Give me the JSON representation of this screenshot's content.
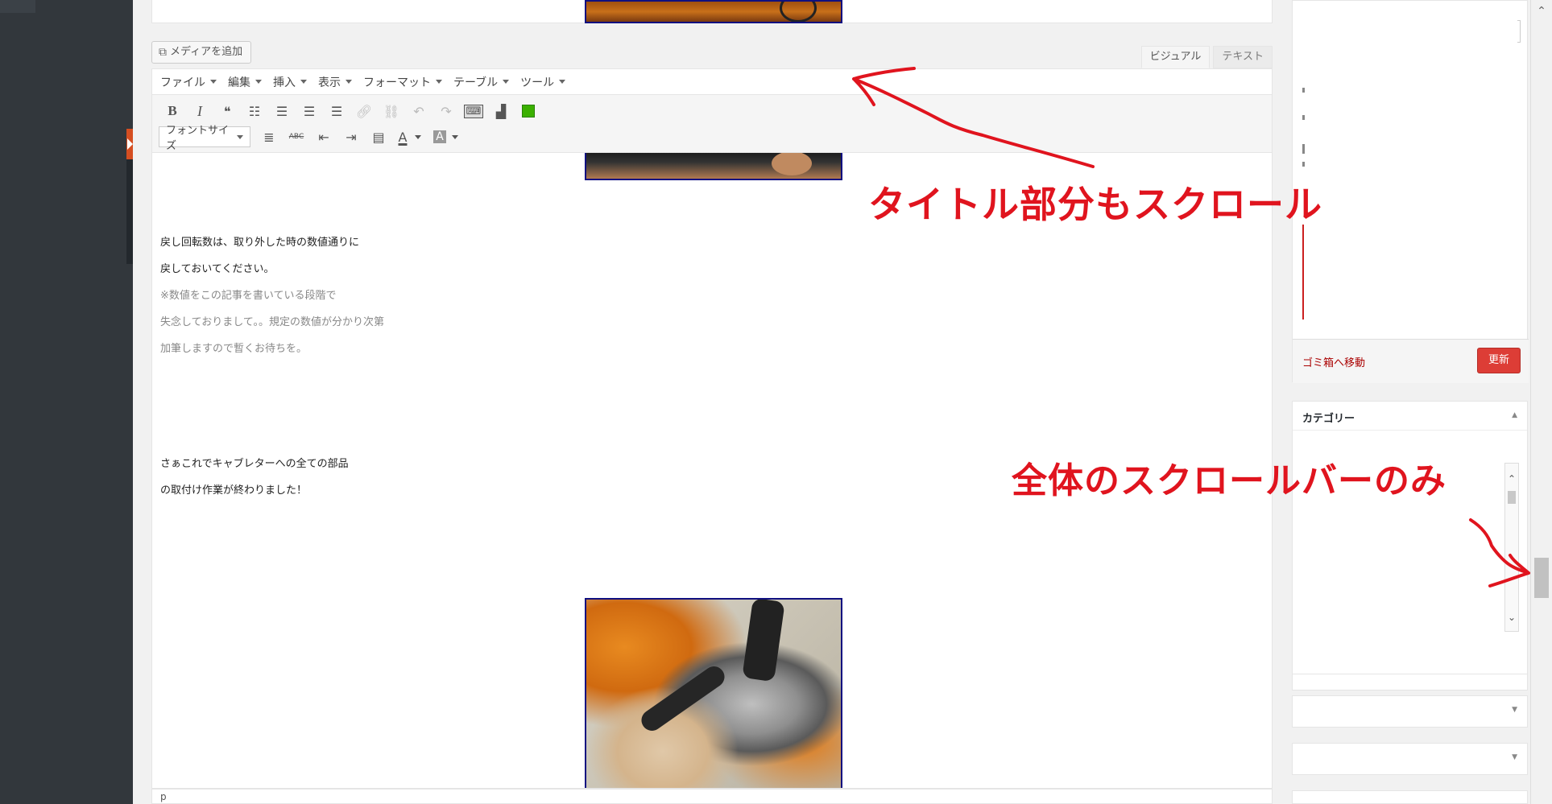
{
  "editor": {
    "add_media_label": "メディアを追加",
    "tabs": [
      {
        "label": "ビジュアル",
        "active": true
      },
      {
        "label": "テキスト",
        "active": false
      }
    ],
    "menu": [
      {
        "label": "ファイル"
      },
      {
        "label": "編集"
      },
      {
        "label": "挿入"
      },
      {
        "label": "表示"
      },
      {
        "label": "フォーマット"
      },
      {
        "label": "テーブル"
      },
      {
        "label": "ツール"
      }
    ],
    "toolbar": {
      "bold": "B",
      "italic": "I",
      "blockquote": "❝",
      "fontsize_label": "フォントサイズ",
      "strikethrough": "ABC",
      "text_color": "A",
      "bg_color": "A"
    },
    "content_lines": [
      {
        "text": "戻し回転数は、取り外した時の数値通りに",
        "style": "normal"
      },
      {
        "text": "戻しておいてください。",
        "style": "normal"
      },
      {
        "text": "※数値をこの記事を書いている段階で",
        "style": "gray"
      },
      {
        "text": "失念しておりまして。。規定の数値が分かり次第",
        "style": "gray"
      },
      {
        "text": "加筆しますので暫くお待ちを。",
        "style": "gray"
      },
      {
        "text": "さぁこれでキャブレターへの全ての部品",
        "style": "normal"
      },
      {
        "text": "の取付け作業が終わりました！",
        "style": "normal"
      }
    ],
    "status_path": "p"
  },
  "sidebar": {
    "trash_label": "ゴミ箱へ移動",
    "update_label": "更新",
    "category_title": "カテゴリー"
  },
  "annotations": {
    "title_scroll": "タイトル部分もスクロール",
    "whole_scroll": "全体のスクロールバーのみ"
  },
  "colors": {
    "annotation_red": "#e0141e",
    "update_button": "#dd3d36",
    "admin_sidebar": "#32373c"
  }
}
